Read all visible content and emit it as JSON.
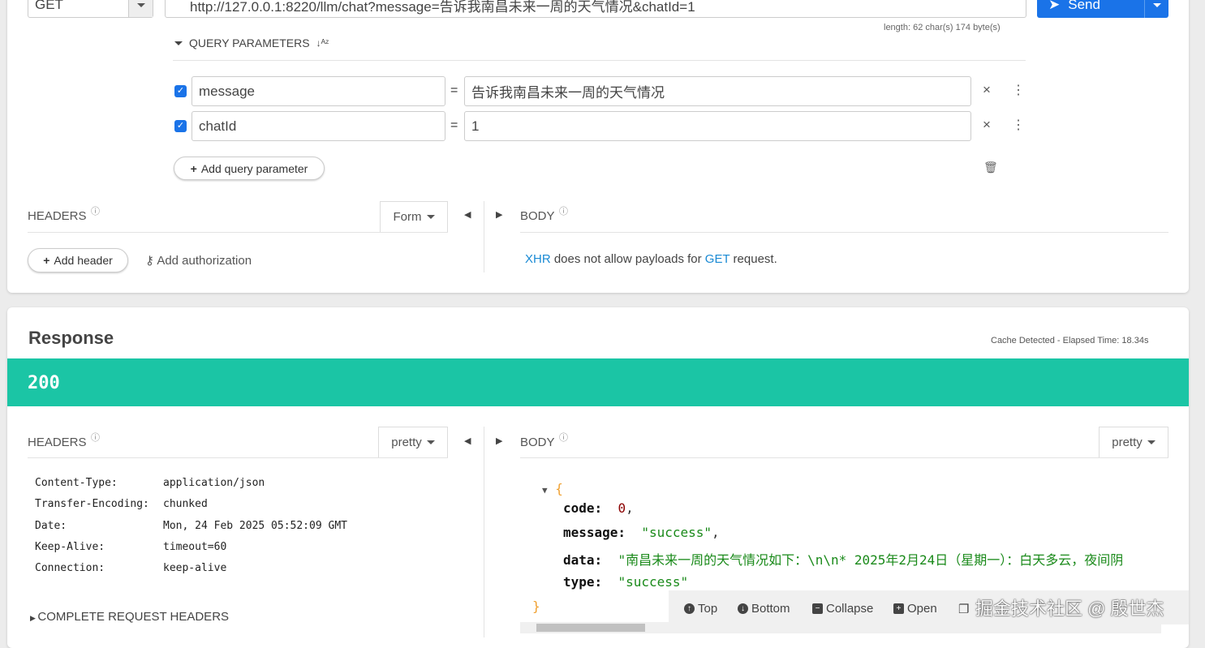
{
  "request": {
    "method": "GET",
    "url": "http://127.0.0.1:8220/llm/chat?message=告诉我南昌未来一周的天气情况&chatId=1",
    "send_label": "Send",
    "length_info": "length: 62 char(s) 174 byte(s)",
    "query_params_label": "QUERY PARAMETERS",
    "params": [
      {
        "name": "message",
        "value": "告诉我南昌未来一周的天气情况",
        "enabled": true
      },
      {
        "name": "chatId",
        "value": "1",
        "enabled": true
      }
    ],
    "equals": "=",
    "add_param_label": "Add query parameter",
    "headers_label": "HEADERS",
    "headers_mode": "Form",
    "add_header_label": "Add header",
    "add_auth_label": "Add authorization",
    "body_label": "BODY",
    "body_msg": {
      "a": "XHR",
      "b": " does not allow payloads for ",
      "c": "GET",
      "d": " request."
    }
  },
  "response": {
    "title": "Response",
    "cache_info": "Cache Detected - Elapsed Time: 18.34s",
    "status": "200",
    "status_color": "#1bc5a5",
    "headers_label": "HEADERS",
    "headers_mode": "pretty",
    "body_label": "BODY",
    "body_mode": "pretty",
    "headers": [
      {
        "k": "Content-Type:",
        "v": "application/json"
      },
      {
        "k": "Transfer-Encoding:",
        "v": "chunked"
      },
      {
        "k": "Date:",
        "v": "Mon, 24 Feb 2025 05:52:09 GMT"
      },
      {
        "k": "Keep-Alive:",
        "v": "timeout=60"
      },
      {
        "k": "Connection:",
        "v": "keep-alive"
      }
    ],
    "complete_headers_label": "COMPLETE REQUEST HEADERS",
    "json": {
      "open": "{",
      "close": "}",
      "code_k": "code:",
      "code_v": "0",
      "message_k": "message:",
      "message_v": "\"success\"",
      "data_k": "data:",
      "data_v": "\"南昌未来一周的天气情况如下：\\n\\n* 2025年2月24日（星期一）：白天多云，夜间阴",
      "type_k": "type:",
      "type_v": "\"success\"",
      "comma": ","
    },
    "toolbar": {
      "top": "Top",
      "bottom": "Bottom",
      "collapse": "Collapse",
      "open": "Open"
    }
  },
  "watermark": "掘金技术社区 @ 殷世杰"
}
